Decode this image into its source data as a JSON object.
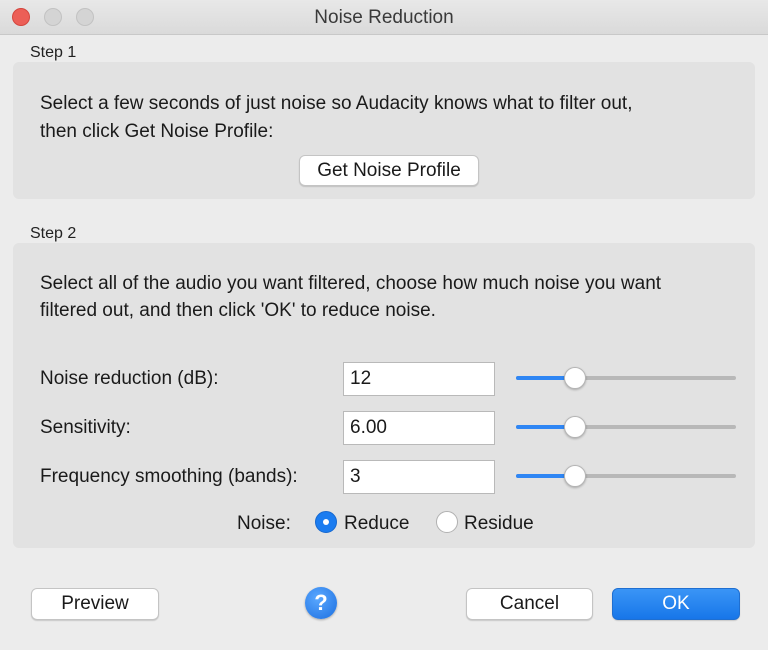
{
  "window": {
    "title": "Noise Reduction"
  },
  "step1": {
    "label": "Step 1",
    "line1": "Select a few seconds of just noise so Audacity knows what to filter out,",
    "line2": "then click Get Noise Profile:",
    "button": "Get Noise Profile"
  },
  "step2": {
    "label": "Step 2",
    "line1": "Select all of the audio you want filtered, choose how much noise you want",
    "line2": "filtered out, and then click 'OK' to reduce noise.",
    "rows": [
      {
        "label": "Noise reduction (dB):",
        "value": "12",
        "slider_fraction": 0.27
      },
      {
        "label": "Sensitivity:",
        "value": "6.00",
        "slider_fraction": 0.27
      },
      {
        "label": "Frequency smoothing (bands):",
        "value": "3",
        "slider_fraction": 0.27
      }
    ],
    "noise": {
      "label": "Noise:",
      "options": [
        "Reduce",
        "Residue"
      ],
      "selected": "Reduce"
    }
  },
  "footer": {
    "preview": "Preview",
    "help": "?",
    "cancel": "Cancel",
    "ok": "OK"
  },
  "colors": {
    "accent": "#1b7cf0",
    "close_light": "#ec5f57"
  },
  "icons": {
    "help": "help-icon",
    "close": "close-window-icon"
  }
}
